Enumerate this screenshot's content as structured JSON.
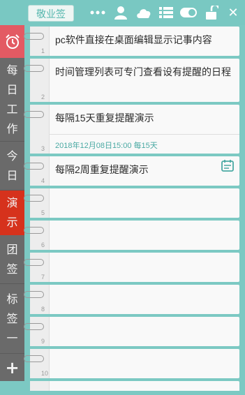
{
  "app": {
    "logo_text": "敬业签"
  },
  "topbar": {
    "icons": [
      "more-icon",
      "user-icon",
      "cloud-icon",
      "list-icon",
      "toggle-icon",
      "unlock-icon",
      "close-icon"
    ],
    "close_label": "✕"
  },
  "sidebar": {
    "alarm_icon": "alarm-clock-icon",
    "items": [
      {
        "id": "daily-work",
        "chars": [
          "每",
          "日",
          "工",
          "作"
        ]
      },
      {
        "id": "today",
        "chars": [
          "今",
          "日"
        ]
      },
      {
        "id": "demo",
        "chars": [
          "演",
          "示"
        ],
        "active": true
      },
      {
        "id": "team",
        "chars": [
          "团",
          "签"
        ]
      },
      {
        "id": "tag",
        "chars": [
          "标",
          "签",
          "一"
        ]
      }
    ],
    "add_label": "+"
  },
  "notes": [
    {
      "number": "1",
      "text": "pc软件直接在桌面编辑显示记事内容"
    },
    {
      "number": "2",
      "text": "时间管理列表可专门查看设有提醒的日程"
    },
    {
      "number": "3",
      "text": "每隔15天重复提醒演示",
      "reminder": "2018年12月08日15:00 每15天"
    },
    {
      "number": "4",
      "text": "每隔2周重复提醒演示",
      "icon": "calendar-icon"
    },
    {
      "number": "5",
      "text": ""
    },
    {
      "number": "6",
      "text": ""
    },
    {
      "number": "7",
      "text": ""
    },
    {
      "number": "8",
      "text": ""
    },
    {
      "number": "9",
      "text": ""
    },
    {
      "number": "10",
      "text": ""
    }
  ],
  "colors": {
    "teal": "#79c8c2",
    "sidebar": "#6a6a6a",
    "alarm": "#e35a63",
    "active": "#d6321c",
    "reminder_text": "#4aa9a3"
  }
}
